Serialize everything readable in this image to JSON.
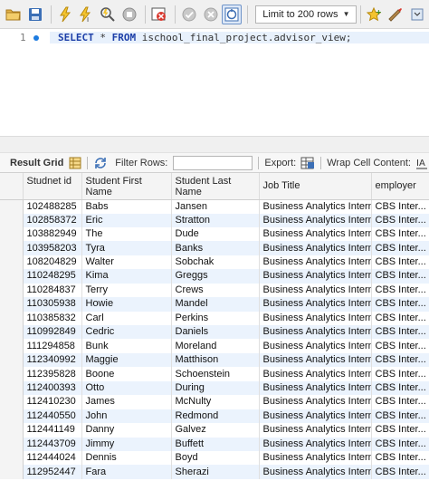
{
  "toolbar": {
    "limit_label": "Limit to 200 rows",
    "icons": [
      "open-folder-icon",
      "save-icon",
      "execute-icon",
      "execute-current-icon",
      "explain-icon",
      "stop-icon",
      "toggle-error-icon",
      "commit-icon",
      "rollback-icon",
      "autocommit-icon",
      "add-snippet-icon",
      "beautify-icon"
    ]
  },
  "editor": {
    "line_number": "1",
    "keyword_select": "SELECT",
    "star": " * ",
    "keyword_from": "FROM",
    "target": " ischool_final_project.advisor_view;"
  },
  "result_toolbar": {
    "result_grid_label": "Result Grid",
    "filter_label": "Filter Rows:",
    "filter_value": "",
    "export_label": "Export:",
    "wrap_label": "Wrap Cell Content:"
  },
  "grid": {
    "columns": [
      "Studnet id",
      "Student First Name",
      "Student Last Name",
      "Job Title",
      "employer"
    ],
    "rows": [
      [
        "102488285",
        "Babs",
        "Jansen",
        "Business Analytics Intern",
        "CBS Inter..."
      ],
      [
        "102858372",
        "Eric",
        "Stratton",
        "Business Analytics Intern",
        "CBS Inter..."
      ],
      [
        "103882949",
        "The",
        "Dude",
        "Business Analytics Intern",
        "CBS Inter..."
      ],
      [
        "103958203",
        "Tyra",
        "Banks",
        "Business Analytics Intern",
        "CBS Inter..."
      ],
      [
        "108204829",
        "Walter",
        "Sobchak",
        "Business Analytics Intern",
        "CBS Inter..."
      ],
      [
        "110248295",
        "Kima",
        "Greggs",
        "Business Analytics Intern",
        "CBS Inter..."
      ],
      [
        "110284837",
        "Terry",
        "Crews",
        "Business Analytics Intern",
        "CBS Inter..."
      ],
      [
        "110305938",
        "Howie",
        "Mandel",
        "Business Analytics Intern",
        "CBS Inter..."
      ],
      [
        "110385832",
        "Carl",
        "Perkins",
        "Business Analytics Intern",
        "CBS Inter..."
      ],
      [
        "110992849",
        "Cedric",
        "Daniels",
        "Business Analytics Intern",
        "CBS Inter..."
      ],
      [
        "111294858",
        "Bunk",
        "Moreland",
        "Business Analytics Intern",
        "CBS Inter..."
      ],
      [
        "112340992",
        "Maggie",
        "Matthison",
        "Business Analytics Intern",
        "CBS Inter..."
      ],
      [
        "112395828",
        "Boone",
        "Schoenstein",
        "Business Analytics Intern",
        "CBS Inter..."
      ],
      [
        "112400393",
        "Otto",
        "During",
        "Business Analytics Intern",
        "CBS Inter..."
      ],
      [
        "112410230",
        "James",
        "McNulty",
        "Business Analytics Intern",
        "CBS Inter..."
      ],
      [
        "112440550",
        "John",
        "Redmond",
        "Business Analytics Intern",
        "CBS Inter..."
      ],
      [
        "112441149",
        "Danny",
        "Galvez",
        "Business Analytics Intern",
        "CBS Inter..."
      ],
      [
        "112443709",
        "Jimmy",
        "Buffett",
        "Business Analytics Intern",
        "CBS Inter..."
      ],
      [
        "112444024",
        "Dennis",
        "Boyd",
        "Business Analytics Intern",
        "CBS Inter..."
      ],
      [
        "112952447",
        "Fara",
        "Sherazi",
        "Business Analytics Intern",
        "CBS Inter..."
      ]
    ]
  }
}
